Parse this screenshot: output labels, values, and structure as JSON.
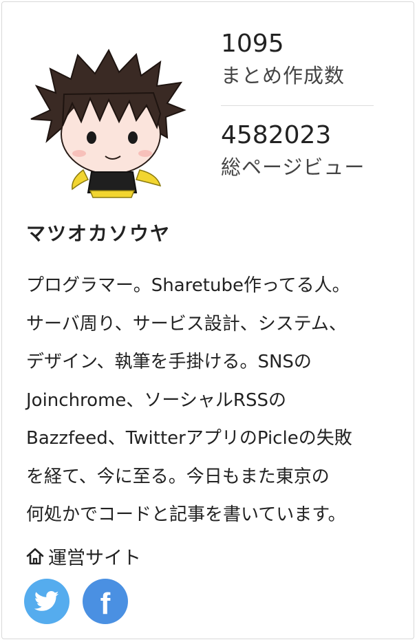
{
  "profile": {
    "name": "マツオカソウヤ",
    "bio": "プログラマー。Sharetube作ってる人。サーバ周り、サービス設計、システム、デザイン、執筆を手掛ける。SNSのJoinchrome、ソーシャルRSSのBazzfeed、TwitterアプリのPicleの失敗を経て、今に至る。今日もまた東京の何処かでコードと記事を書いています。",
    "bio_lines": [
      "プログラマー。Sharetube作ってる人。",
      "サーバ周り、サービス設計、システム、",
      "デザイン、執筆を手掛ける。SNSの",
      "Joinchrome、ソーシャルRSSの",
      "Bazzfeed、TwitterアプリのPicleの失敗",
      "を経て、今に至る。今日もまた東京の",
      "何処かでコードと記事を書いています。"
    ]
  },
  "stats": {
    "summaries_count": "1095",
    "summaries_label": "まとめ作成数",
    "pageviews_count": "4582023",
    "pageviews_label": "総ページビュー"
  },
  "links": {
    "site_label": "運営サイト",
    "site_icon": "home-icon"
  },
  "social": {
    "twitter": {
      "icon": "twitter-bird-icon",
      "color": "#55acee"
    },
    "facebook": {
      "icon": "facebook-f-icon",
      "letter": "f",
      "color": "#4a90e2"
    }
  },
  "colors": {
    "avatar_hair": "#3a2a24",
    "avatar_skin": "#fbe4dc",
    "avatar_outfit": "#f2d530"
  }
}
